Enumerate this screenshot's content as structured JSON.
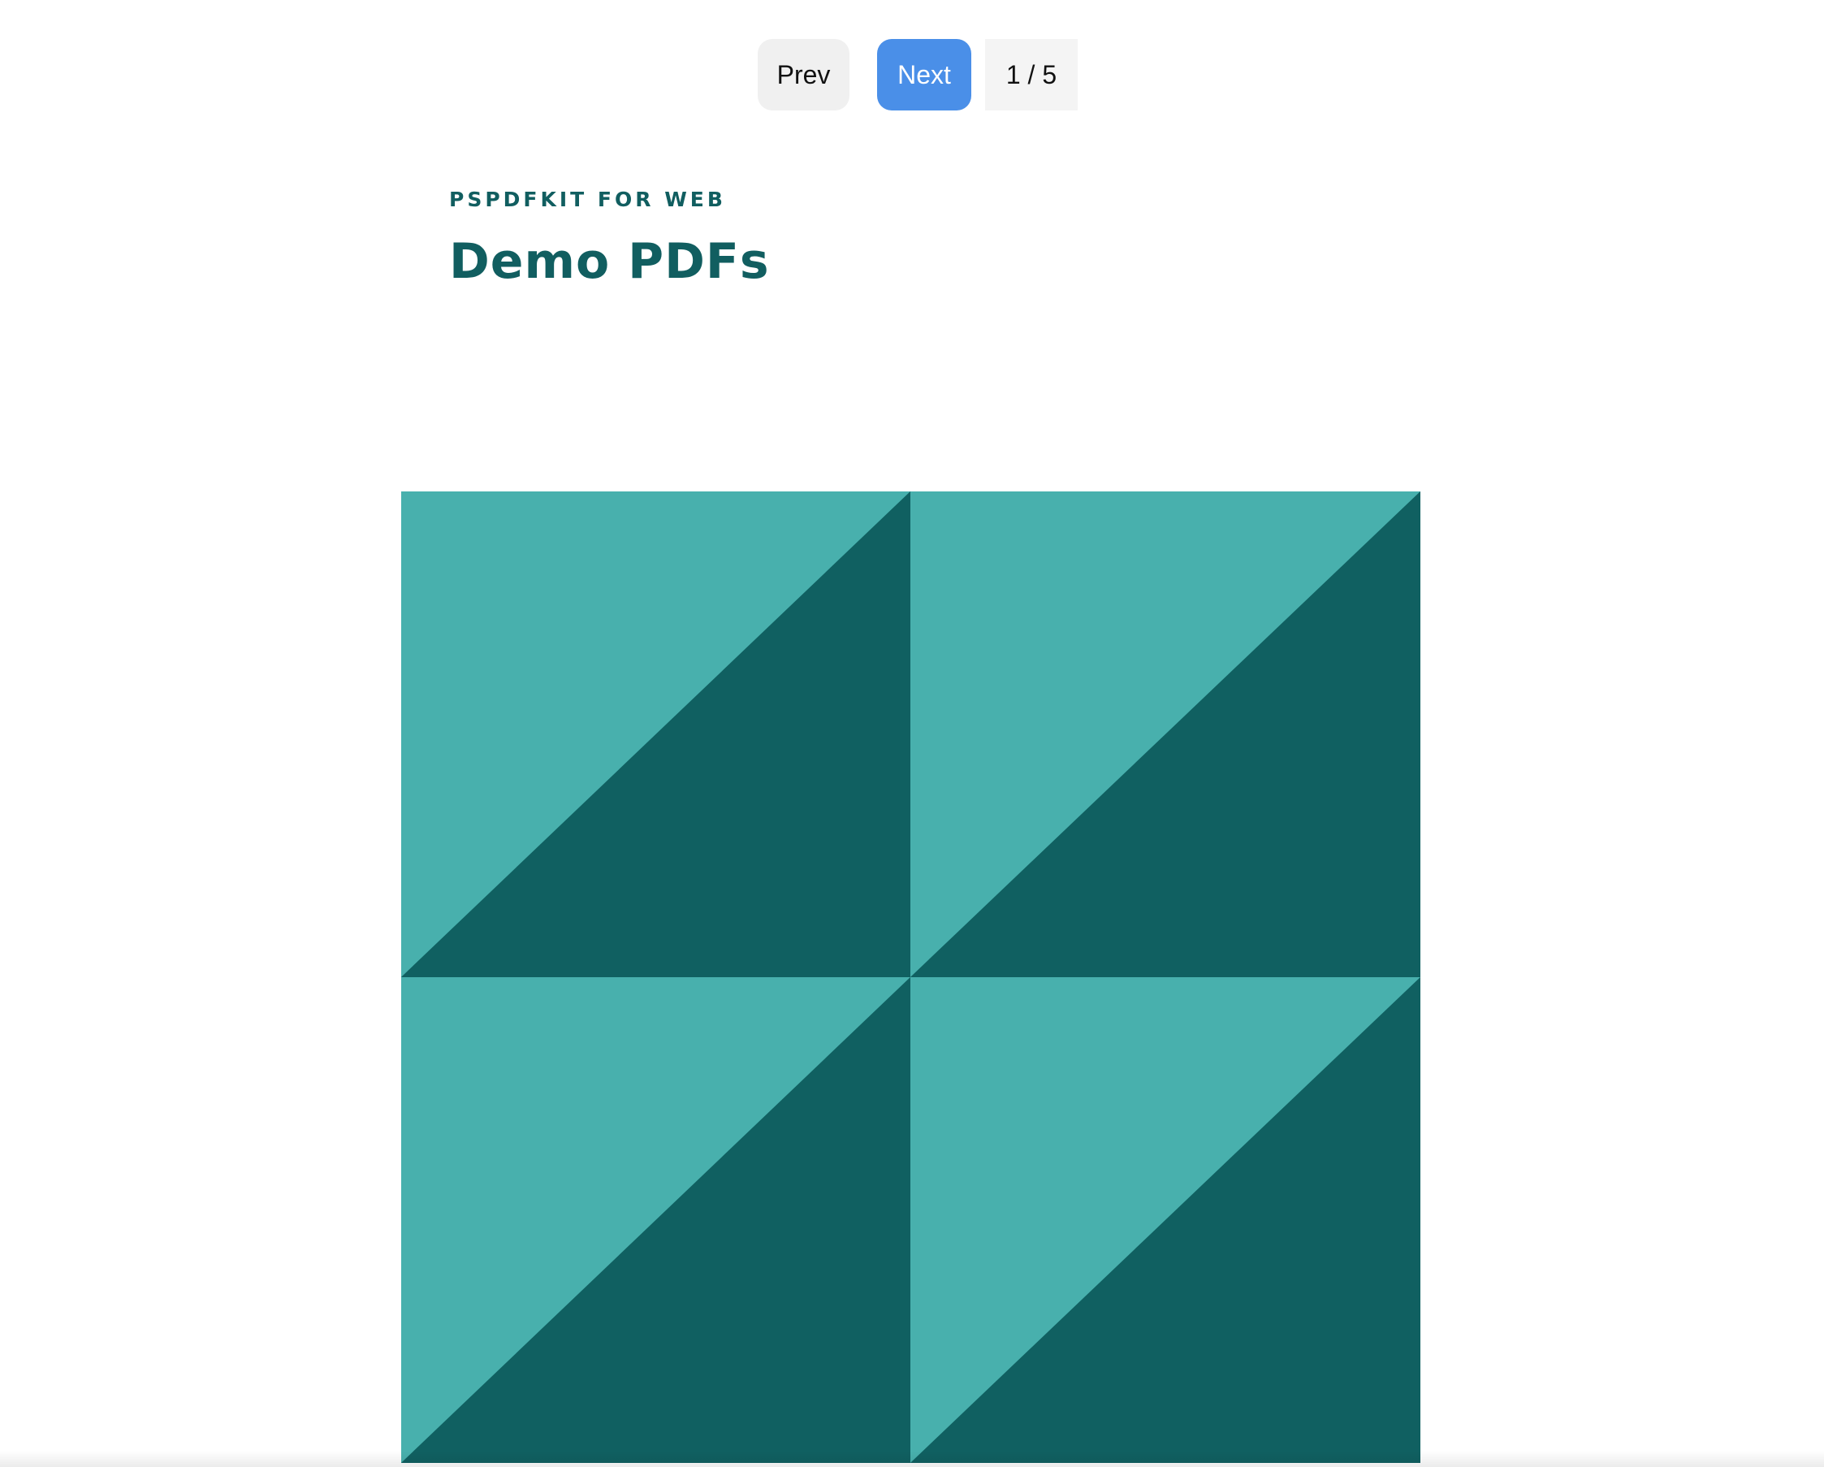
{
  "toolbar": {
    "prev_label": "Prev",
    "next_label": "Next",
    "page_indicator": "1 / 5",
    "current_page": 1,
    "total_pages": 5,
    "next_color": "#4a8fe8",
    "prev_color": "#f0f0f0"
  },
  "document": {
    "eyebrow": "PSPDFKIT FOR WEB",
    "title": "Demo PDFs",
    "text_color": "#115e60"
  },
  "artwork": {
    "pattern": "triangles-grid",
    "light_color": "#48b0ad",
    "dark_color": "#106061"
  }
}
